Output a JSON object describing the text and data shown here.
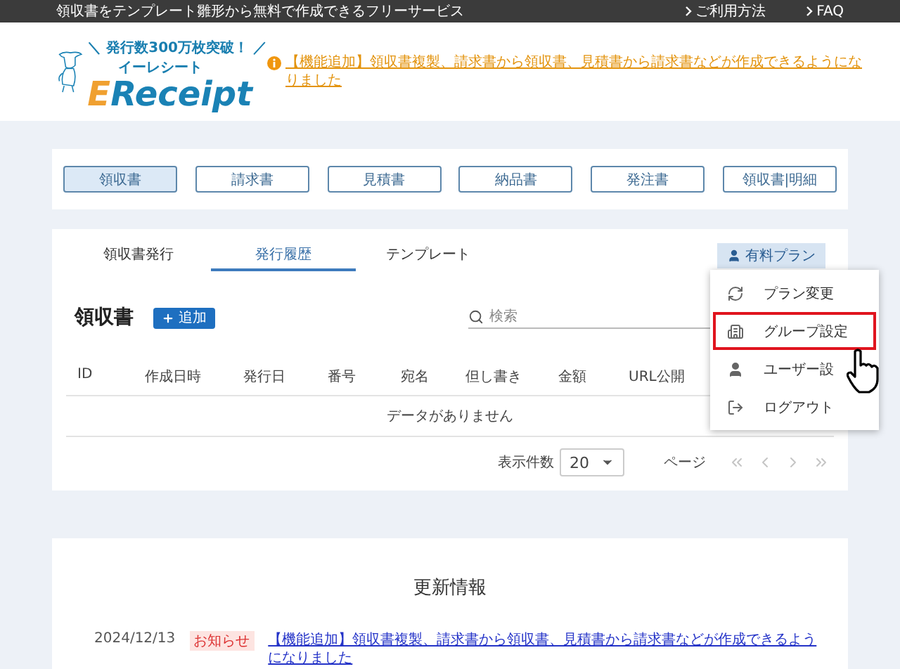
{
  "top_bar": {
    "tagline": "領収書をテンプレート雛形から無料で作成できるフリーサービス",
    "links": [
      "ご利用方法",
      "FAQ"
    ]
  },
  "header": {
    "logo": {
      "mark_left": "＼",
      "catch": "発行数300万枚突破！",
      "mark_right": "／",
      "kana": "イーレシート",
      "initial": "E",
      "rest": "Receipt"
    },
    "notice": "【機能追加】領収書複製、請求書から領収書、見積書から請求書などが作成できるようになりました"
  },
  "doc_types": [
    {
      "label": "領収書",
      "selected": true
    },
    {
      "label": "請求書",
      "selected": false
    },
    {
      "label": "見積書",
      "selected": false
    },
    {
      "label": "納品書",
      "selected": false
    },
    {
      "label": "発注書",
      "selected": false
    },
    {
      "label": "領収書|明細",
      "selected": false
    }
  ],
  "tabs": [
    {
      "label": "領収書発行",
      "selected": false
    },
    {
      "label": "発行履歴",
      "selected": true
    },
    {
      "label": "テンプレート",
      "selected": false
    }
  ],
  "plan_button": "有料プラン",
  "menu": [
    {
      "kind": "refresh",
      "label": "プラン変更",
      "highlighted": false
    },
    {
      "kind": "building",
      "label": "グループ設定",
      "highlighted": true
    },
    {
      "kind": "user",
      "label": "ユーザー設",
      "highlighted": false
    },
    {
      "kind": "logout",
      "label": "ログアウト",
      "highlighted": false
    }
  ],
  "list": {
    "title": "領収書",
    "add_button": "追加",
    "search": {
      "placeholder": "検索"
    },
    "columns": [
      "ID",
      "作成日時",
      "発行日",
      "番号",
      "宛名",
      "但し書き",
      "金額",
      "URL公開"
    ],
    "empty": "データがありません",
    "page_size_label": "表示件数",
    "page_size": "20",
    "page_label": "ページ"
  },
  "updates": {
    "title": "更新情報",
    "items": [
      {
        "date": "2024/12/13",
        "badge": "お知らせ",
        "text": "【機能追加】領収書複製、請求書から領収書、見積書から請求書などが作成できるようになりました"
      }
    ]
  }
}
